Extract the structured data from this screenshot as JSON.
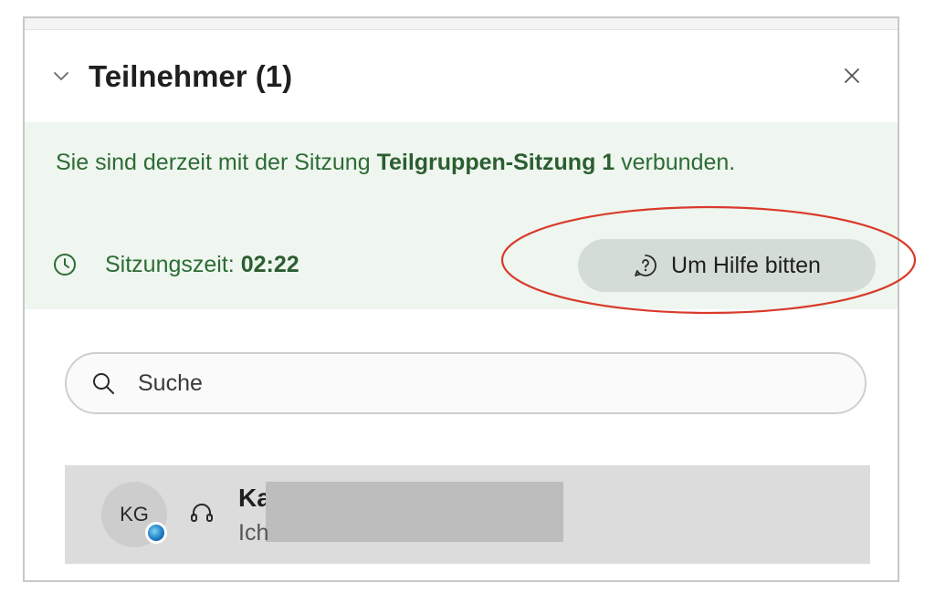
{
  "panel": {
    "title": "Teilnehmer (1)"
  },
  "banner": {
    "text_before": "Sie sind derzeit mit der Sitzung ",
    "session_name": "Teilgruppen-Sitzung 1",
    "text_after": " verbunden.",
    "time_label": "Sitzungszeit: ",
    "time_value": "02:22",
    "help_button_label": "Um Hilfe bitten"
  },
  "search": {
    "placeholder": "Suche"
  },
  "participants": [
    {
      "initials": "KG",
      "name": "Ka",
      "subtitle": "Ich"
    }
  ],
  "colors": {
    "banner_bg": "#eef6ef",
    "banner_text": "#2e6b35",
    "annotation_ring": "#d93a2b",
    "participant_row_bg": "#dcdcdc"
  },
  "icons": {
    "collapse": "chevron-down-icon",
    "close": "close-icon",
    "clock": "clock-icon",
    "help": "help-icon",
    "search": "search-icon",
    "headset": "headset-icon",
    "presence": "presence-icon"
  }
}
